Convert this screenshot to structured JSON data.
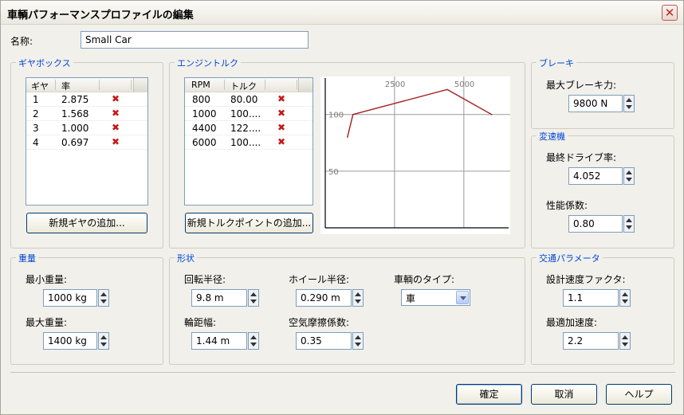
{
  "window": {
    "title": "車輌パフォーマンスプロファイルの編集"
  },
  "name": {
    "label": "名称:",
    "value": "Small Car"
  },
  "gearbox": {
    "title": "ギヤボックス",
    "headers": [
      "ギヤ",
      "率"
    ],
    "rows": [
      {
        "gear": "1",
        "ratio": "2.875"
      },
      {
        "gear": "2",
        "ratio": "1.568"
      },
      {
        "gear": "3",
        "ratio": "1.000"
      },
      {
        "gear": "4",
        "ratio": "0.697"
      }
    ],
    "add_button": "新規ギヤの追加..."
  },
  "torque": {
    "title": "エンジントルク",
    "headers": [
      "RPM",
      "トルク"
    ],
    "rows": [
      {
        "rpm": "800",
        "torque": "80.00"
      },
      {
        "rpm": "1000",
        "torque": "100...."
      },
      {
        "rpm": "4400",
        "torque": "122...."
      },
      {
        "rpm": "6000",
        "torque": "100...."
      }
    ],
    "add_button": "新規トルクポイントの追加..."
  },
  "chart_data": {
    "type": "line",
    "x": [
      800,
      1000,
      4400,
      6000
    ],
    "y": [
      80,
      100,
      122,
      100
    ],
    "x_ticks": [
      "2500",
      "5000"
    ],
    "y_ticks": [
      "100",
      "50"
    ],
    "xlim": [
      0,
      6500
    ],
    "ylim": [
      0,
      130
    ],
    "line_color": "#a31d1d",
    "grid": true
  },
  "brake": {
    "title": "ブレーキ",
    "max_label": "最大ブレーキ力:",
    "max_value": "9800 N"
  },
  "transmission": {
    "title": "変速機",
    "final_drive_label": "最終ドライブ率:",
    "final_drive_value": "4.052",
    "efficiency_label": "性能係数:",
    "efficiency_value": "0.80"
  },
  "weight": {
    "title": "重量",
    "min_label": "最小重量:",
    "min_value": "1000 kg",
    "max_label": "最大重量:",
    "max_value": "1400 kg"
  },
  "shape": {
    "title": "形状",
    "turn_radius_label": "回転半径:",
    "turn_radius_value": "9.8 m",
    "wheel_radius_label": "ホイール半径:",
    "wheel_radius_value": "0.290 m",
    "vehicle_type_label": "車輌のタイプ:",
    "vehicle_type_value": "車",
    "track_label": "輪距幅:",
    "track_value": "1.44 m",
    "drag_label": "空気摩擦係数:",
    "drag_value": "0.35"
  },
  "traffic": {
    "title": "交通パラメータ",
    "speed_factor_label": "設計速度ファクタ:",
    "speed_factor_value": "1.1",
    "accel_label": "最適加速度:",
    "accel_value": "2.2"
  },
  "footer": {
    "ok": "確定",
    "cancel": "取消",
    "help": "ヘルプ"
  }
}
